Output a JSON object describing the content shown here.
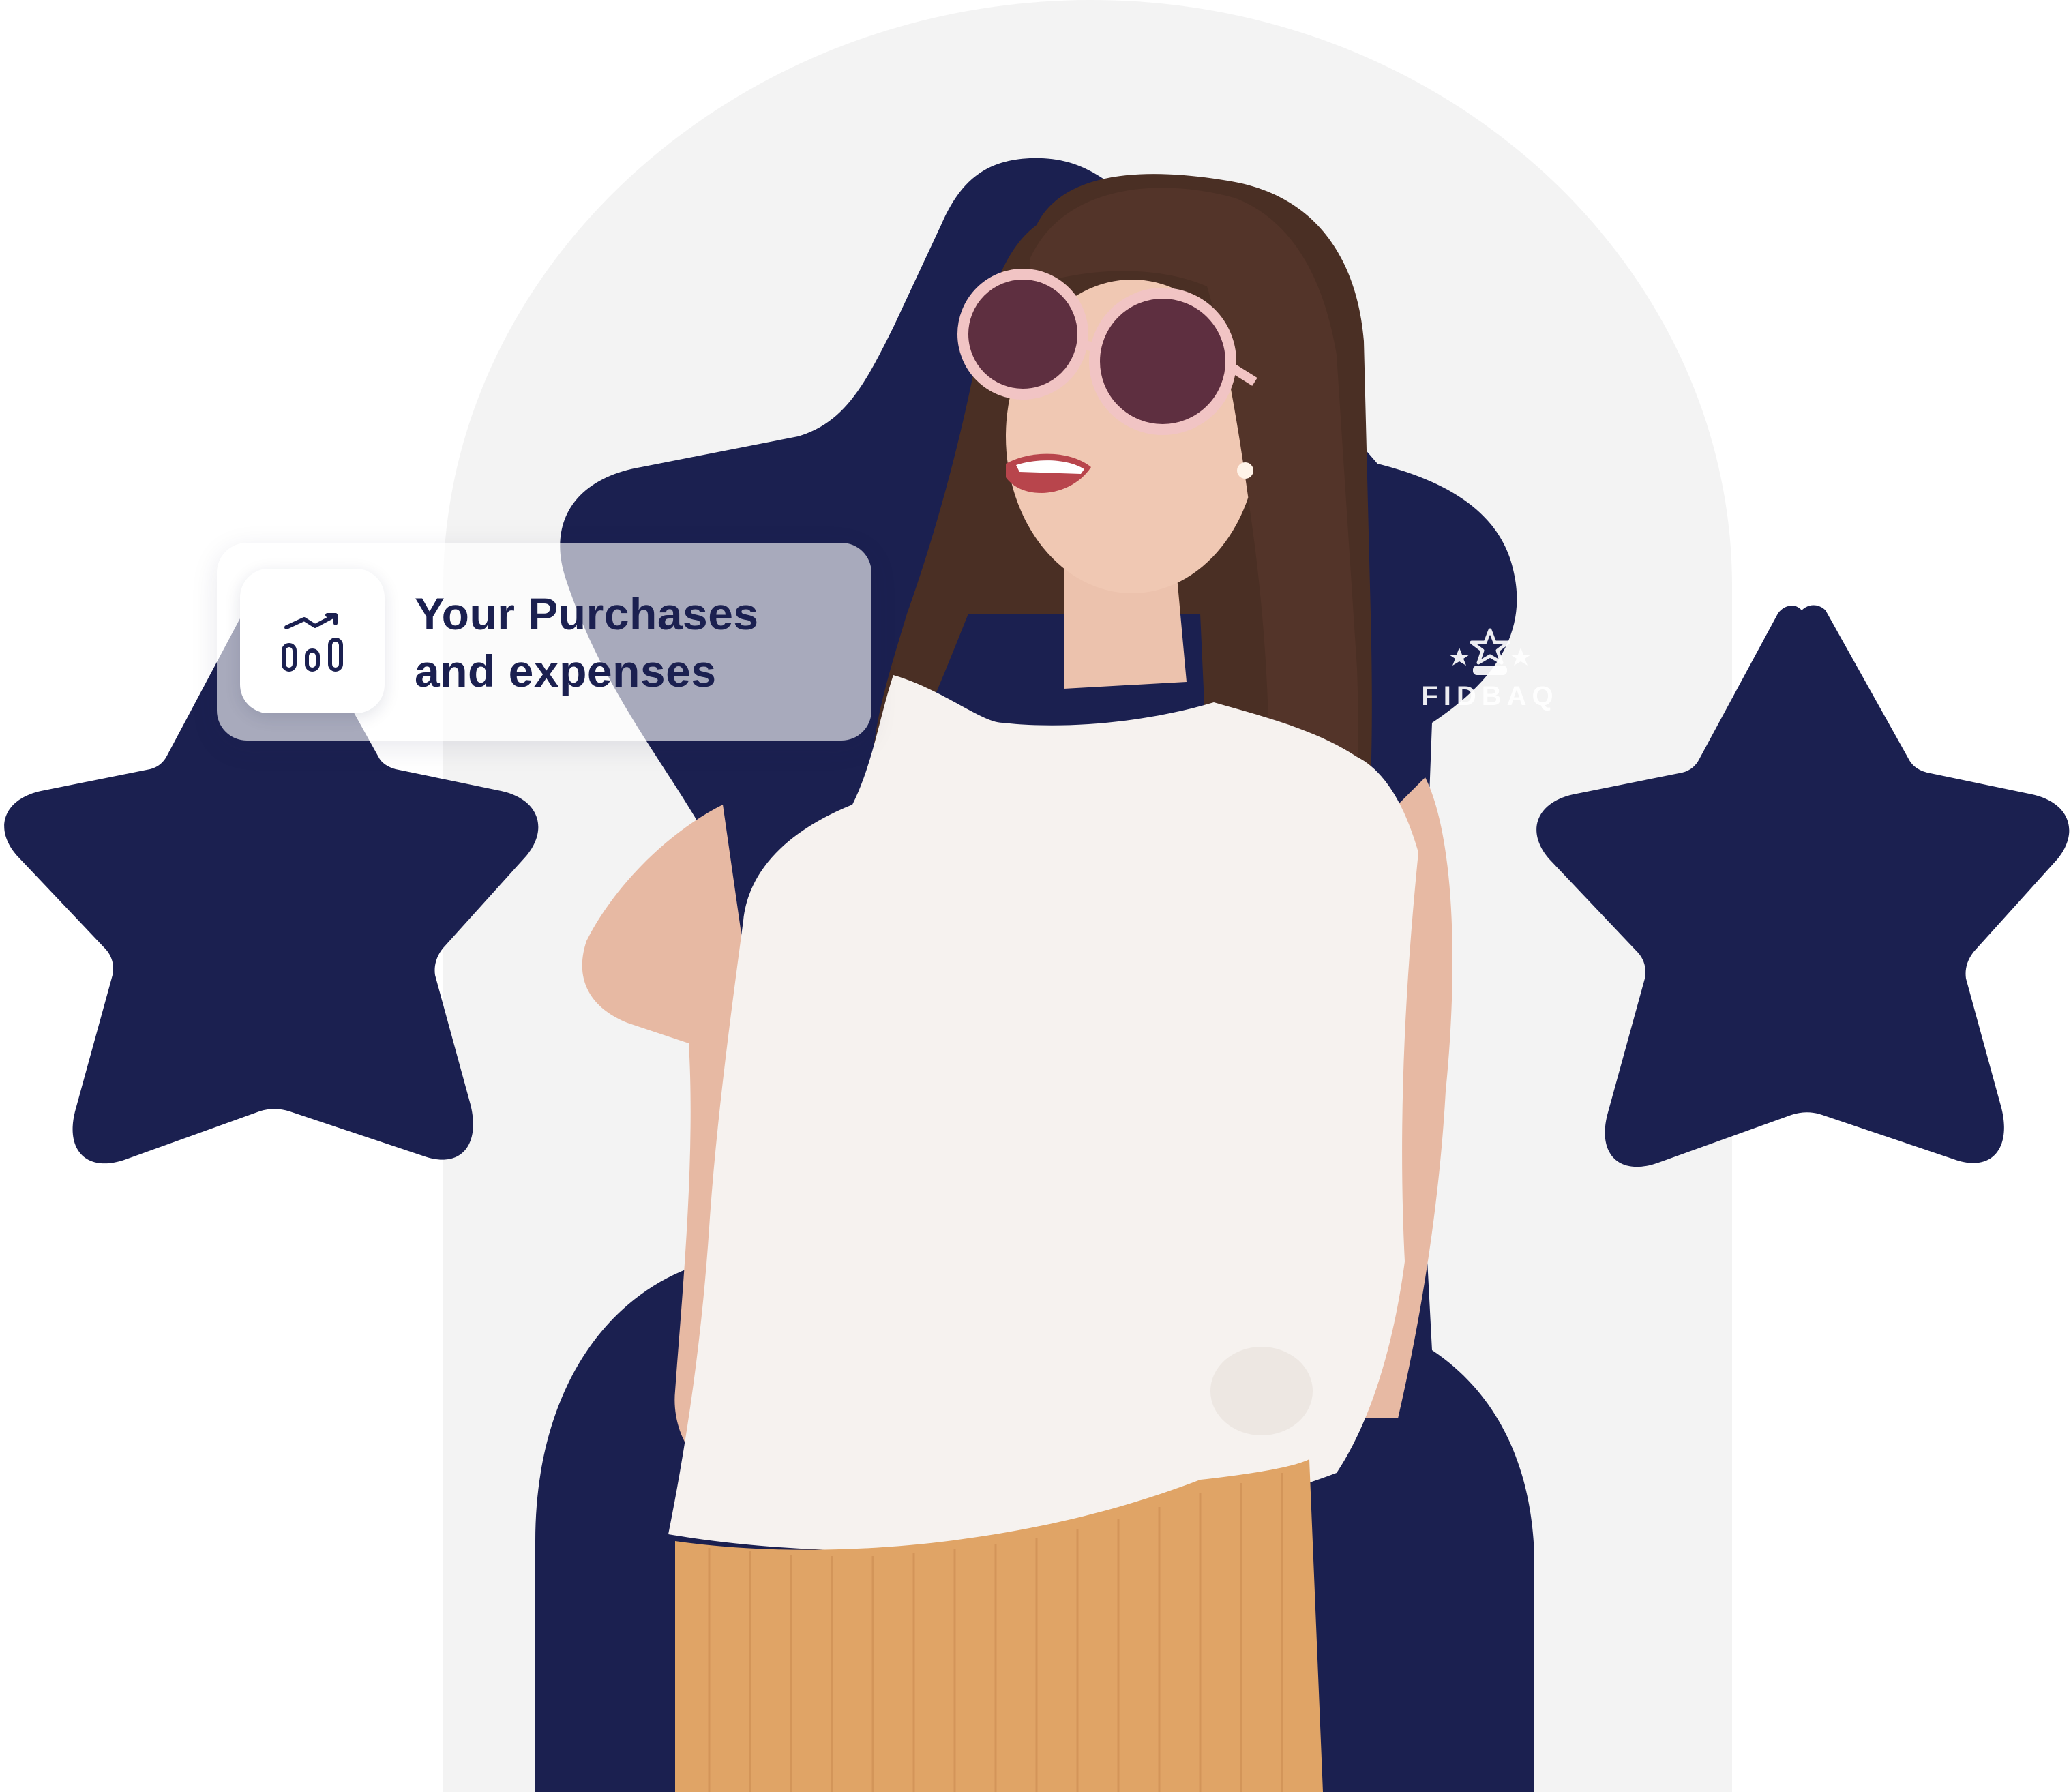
{
  "card": {
    "title_line1": "Your Purchases",
    "title_line2": "and expenses",
    "icon": "bar-chart-trend-icon"
  },
  "brand": {
    "name": "FIDBAQ",
    "icon": "stars-logo-icon"
  },
  "colors": {
    "navy": "#1b2050",
    "arch_gray": "#f3f3f3",
    "background": "#ffffff",
    "shirt": "#f6f2ef",
    "pants": "#e0a466",
    "hair": "#4a2f24"
  },
  "decorations": [
    "left-star-shape",
    "right-star-shape",
    "arch-background",
    "navy-blob-shape"
  ],
  "photo_subject": "person-photo"
}
